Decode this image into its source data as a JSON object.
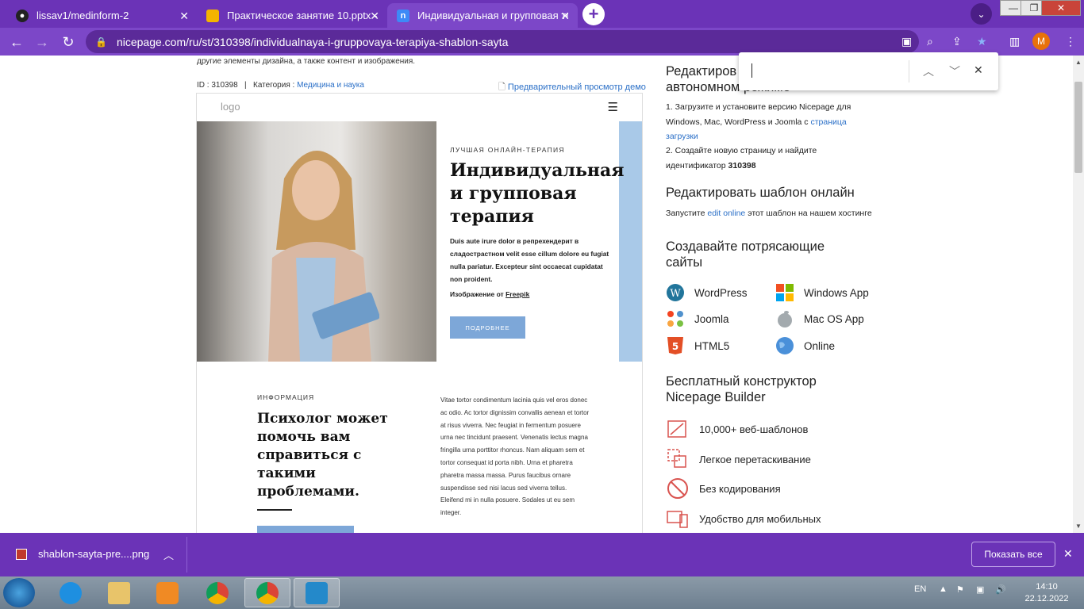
{
  "browser": {
    "tabs": [
      {
        "title": "lissav1/medinform-2",
        "icon": "github-icon"
      },
      {
        "title": "Практическое занятие 10.pptx -",
        "icon": "slides-icon"
      },
      {
        "title": "Индивидуальная и групповая те",
        "icon": "nicepage-icon",
        "active": true
      }
    ],
    "url": "nicepage.com/ru/st/310398/individualnaya-i-gruppovaya-terapiya-shablon-sayta",
    "profile_initial": "M"
  },
  "page": {
    "intro_text": "другие элементы дизайна, а также контент и изображения.",
    "id_label": "ID : 310398",
    "category_prefix": "Категория :",
    "category": "Медицина и наука",
    "preview_link": "Предварительный просмотр демо"
  },
  "template": {
    "logo": "logo",
    "kicker": "ЛУЧШАЯ ОНЛАЙН-ТЕРАПИЯ",
    "headline": "Индивидуальная и групповая терапия",
    "body": "Duis aute irure dolor в репрехендерит в сладострастном velit esse cillum dolore eu fugiat nulla pariatur. Excepteur sint occaecat cupidatat non proident.",
    "credit_prefix": "Изображение от",
    "credit_link": "Freepik",
    "button": "ПОДРОБНЕЕ",
    "info_kicker": "ИНФОРМАЦИЯ",
    "info_heading": "Психолог может помочь вам справиться с такими проблемами.",
    "info_body": "Vitae tortor condimentum lacinia quis vel eros donec ac odio. Ac tortor dignissim convallis aenean et tortor at risus viverra. Nec feugiat in fermentum posuere urna nec tincidunt praesent. Venenatis lectus magna fringilla urna porttitor rhoncus. Nam aliquam sem et tortor consequat id porta nibh. Urna et pharetra pharetra massa massa. Purus faucibus ornare suspendisse sed nisi lacus sed viverra tellus. Eleifend mi in nulla posuere. Sodales ut eu sem integer."
  },
  "sidebar": {
    "offline_title_line1": "Редактиров",
    "offline_title_line2": "автономном режиме",
    "step1_text": "1. Загрузите и установите версию Nicepage для Windows, Mac, WordPress и Joomla с",
    "step1_link": "страница загрузки",
    "step2_text": "2. Создайте новую страницу и найдите идентификатор",
    "step2_id": "310398",
    "online_title": "Редактировать шаблон онлайн",
    "online_prefix": "Запустите",
    "online_link": "edit online",
    "online_suffix": "этот шаблон на нашем хостинге",
    "create_title": "Создавайте потрясающие сайты",
    "platforms": [
      {
        "label": "WordPress",
        "icon": "wordpress-icon"
      },
      {
        "label": "Windows App",
        "icon": "windows-icon"
      },
      {
        "label": "Joomla",
        "icon": "joomla-icon"
      },
      {
        "label": "Mac OS App",
        "icon": "apple-icon"
      },
      {
        "label": "HTML5",
        "icon": "html5-icon"
      },
      {
        "label": "Online",
        "icon": "globe-icon"
      }
    ],
    "builder_title": "Бесплатный конструктор Nicepage Builder",
    "features": [
      {
        "label": "10,000+ веб-шаблонов",
        "icon": "templates-icon"
      },
      {
        "label": "Легкое перетаскивание",
        "icon": "drag-icon"
      },
      {
        "label": "Без кодирования",
        "icon": "no-code-icon"
      },
      {
        "label": "Удобство для мобильных",
        "icon": "mobile-icon"
      }
    ]
  },
  "download_bar": {
    "file": "shablon-sayta-pre....png",
    "show_all": "Показать все"
  },
  "taskbar": {
    "lang": "EN",
    "time": "14:10",
    "date": "22.12.2022"
  },
  "colors": {
    "chrome": "#6b33b7",
    "link": "#2a6fc7",
    "template_blue": "#7da7d8",
    "feature_red": "#d9534f"
  }
}
